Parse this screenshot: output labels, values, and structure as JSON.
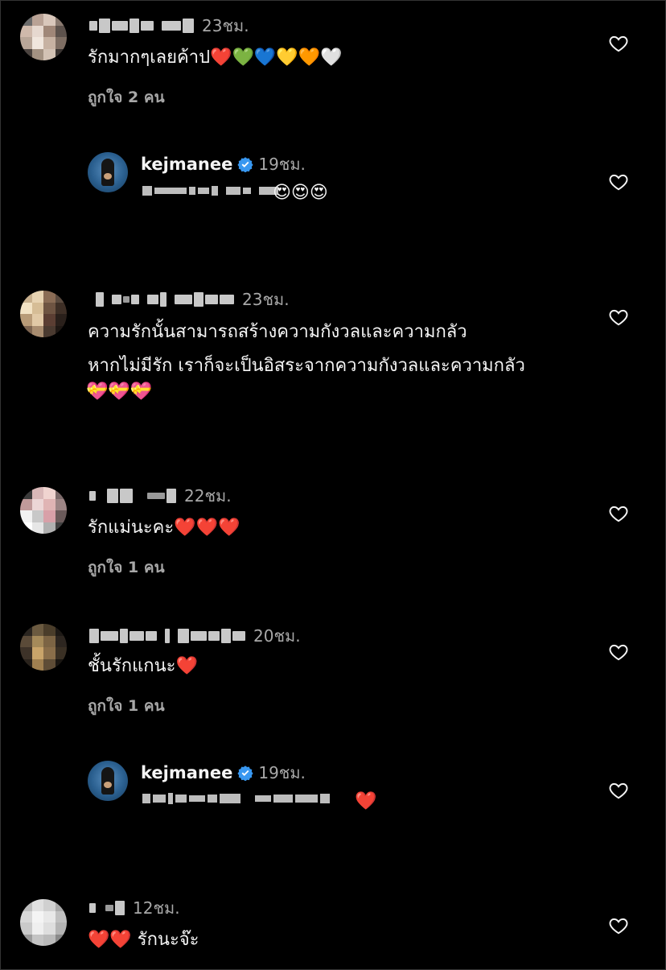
{
  "comments": [
    {
      "time": "23ชม.",
      "text_lines": [
        "รักมากๆเลยค้าป❤️💚💙💛🧡🤍"
      ],
      "likes": "ถูกใจ 2 คน"
    },
    {
      "username": "kejmanee",
      "time": "19ชม.",
      "emojis": "😍😍😍"
    },
    {
      "time": "23ชม.",
      "text_lines": [
        "ความรักนั้นสามารถสร้างความกังวลและความกลัว",
        "หากไม่มีรัก เราก็จะเป็นอิสระจากความกังวลและความกลัว"
      ],
      "emojis": "💝💝💝"
    },
    {
      "time": "22ชม.",
      "text_lines": [
        "รักแม่นะคะ❤️❤️❤️"
      ],
      "likes": "ถูกใจ 1 คน"
    },
    {
      "time": "20ชม.",
      "text_lines": [
        "ชั้นรักแกนะ❤️"
      ],
      "likes": "ถูกใจ 1 คน"
    },
    {
      "username": "kejmanee",
      "time": "19ชม.",
      "emojis": "❤️"
    },
    {
      "time": "12ชม.",
      "text_lines": [
        "❤️❤️ รักนะจ๊ะ"
      ]
    }
  ],
  "icons": {
    "like": "heart-outline-icon",
    "verified": "verified-badge-icon"
  },
  "colors": {
    "background": "#000000",
    "text": "#f5f5f5",
    "secondary": "#a8a8a8",
    "verified": "#3897f0"
  }
}
